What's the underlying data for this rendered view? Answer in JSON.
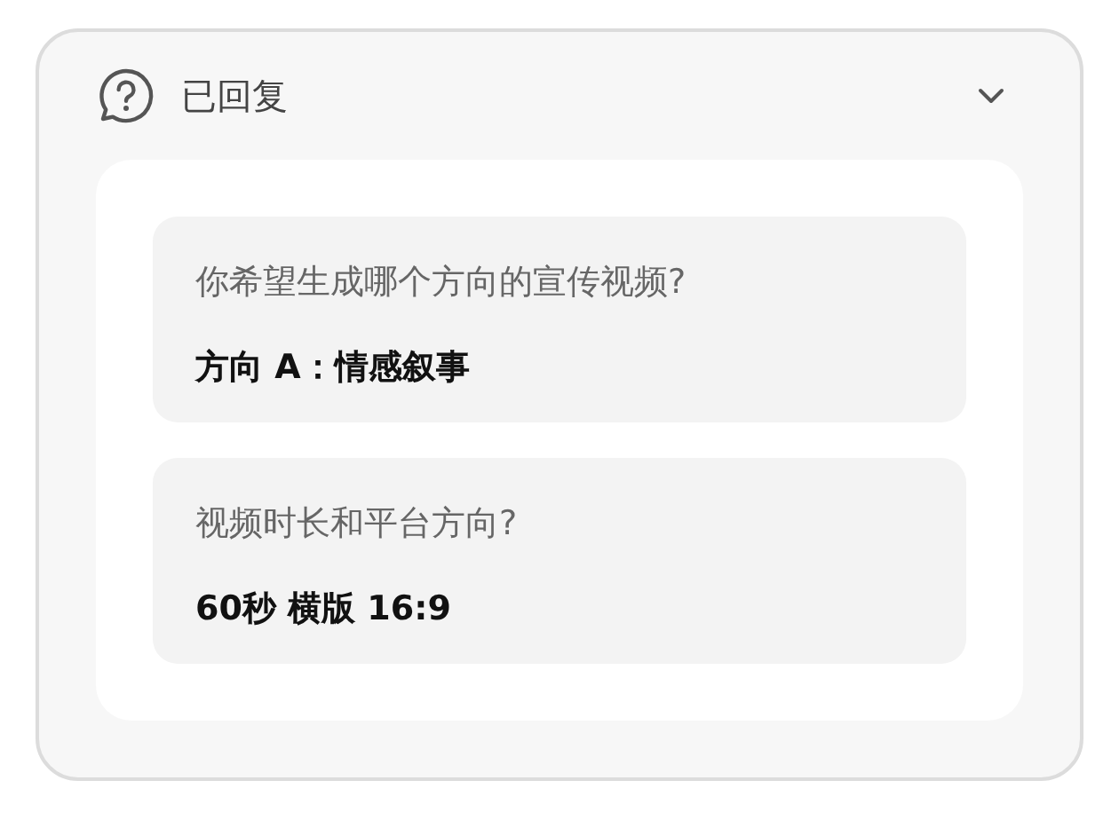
{
  "header": {
    "title": "已回复",
    "expanded": true
  },
  "questions": [
    {
      "question": "你希望生成哪个方向的宣传视频?",
      "answer": "方向 A：情感叙事"
    },
    {
      "question": "视频时长和平台方向?",
      "answer": "60秒 横版 16:9"
    }
  ]
}
